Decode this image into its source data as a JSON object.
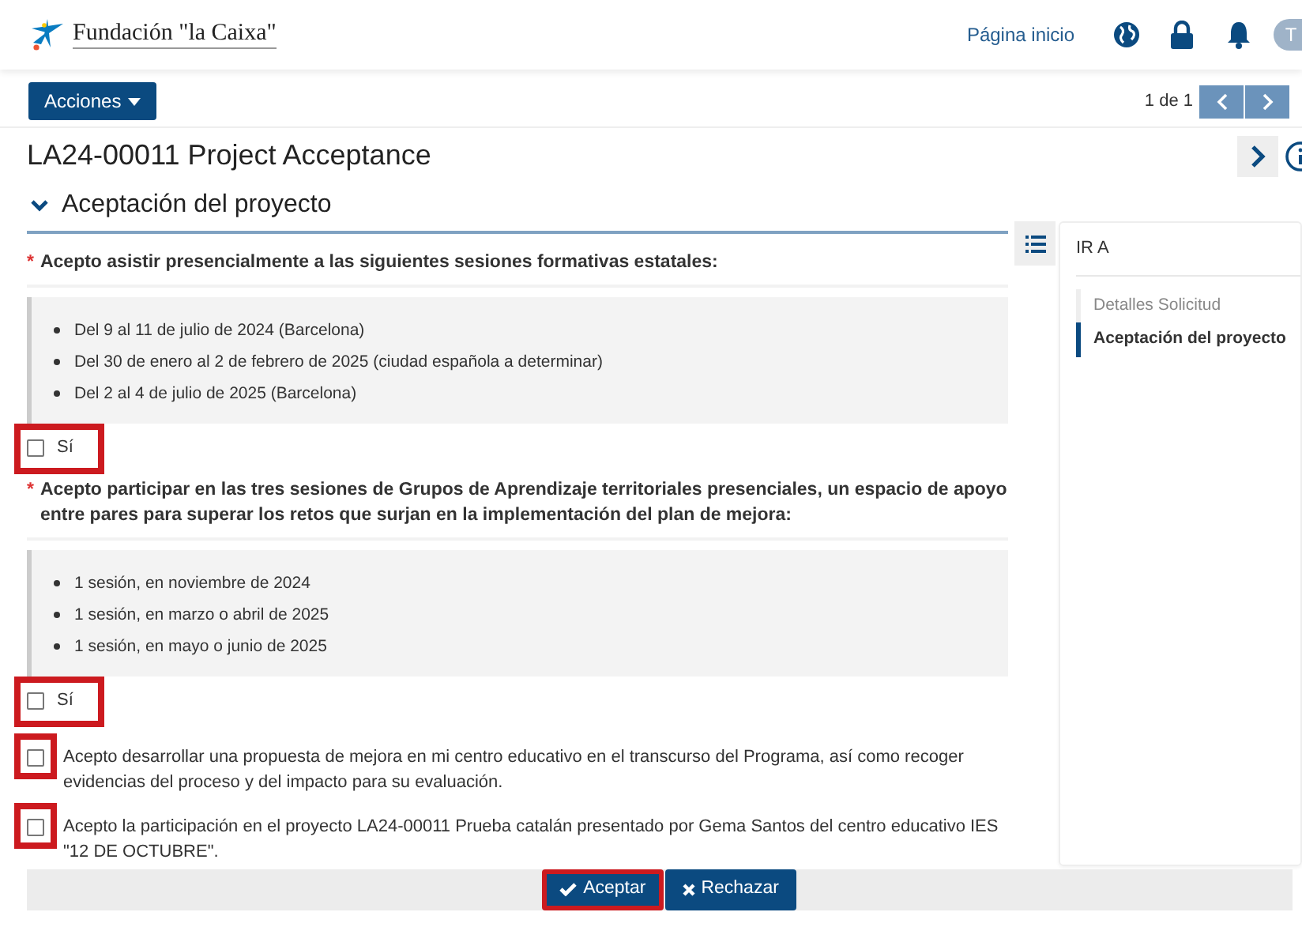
{
  "header": {
    "logo_text": "Fundación \"la Caixa\"",
    "home_link": "Página inicio",
    "avatar_initial": "T"
  },
  "toolbar": {
    "actions_button": "Acciones",
    "pager": "1 de 1"
  },
  "title": "LA24-00011 Project Acceptance",
  "section": {
    "title": "Aceptación del proyecto",
    "expanded": true
  },
  "questions": [
    {
      "kind": "bullets",
      "required_mark": "*",
      "text": "Acepto asistir presencialmente a las siguientes sesiones formativas estatales:",
      "items": [
        "Del 9 al 11 de julio de 2024 (Barcelona)",
        "Del 30 de enero al 2 de febrero de 2025 (ciudad española a determinar)",
        "Del 2 al 4 de julio de 2025 (Barcelona)"
      ],
      "option": {
        "label": "Sí",
        "checked": false,
        "highlighted": true
      }
    },
    {
      "kind": "bullets",
      "required_mark": "*",
      "text": "Acepto participar en las tres sesiones de Grupos de Aprendizaje territoriales presenciales, un espacio de apoyo entre pares para superar los retos que surjan en la implementación del plan de mejora:",
      "items": [
        "1 sesión, en noviembre de 2024",
        "1 sesión, en marzo o abril de 2025",
        "1 sesión, en mayo o junio de 2025"
      ],
      "option": {
        "label": "Sí",
        "checked": false,
        "highlighted": true
      }
    },
    {
      "kind": "checkbox",
      "label": "Acepto desarrollar una propuesta de mejora en mi centro educativo en el transcurso del Programa, así como recoger evidencias del proceso y del impacto para su evaluación.",
      "checked": false,
      "highlighted": true
    },
    {
      "kind": "checkbox",
      "label": "Acepto la participación en el proyecto LA24-00011 Prueba catalán presentado por Gema Santos del centro educativo IES \"12 DE OCTUBRE\".",
      "checked": false,
      "highlighted": true
    }
  ],
  "sidebar": {
    "title": "IR A",
    "items": [
      {
        "label": "Detalles Solicitud",
        "selected": false
      },
      {
        "label": "Aceptación del proyecto",
        "selected": true
      }
    ]
  },
  "footer_buttons": [
    {
      "kind": "accept",
      "label": "Aceptar",
      "highlighted": true
    },
    {
      "kind": "reject",
      "label": "Rechazar",
      "highlighted": false
    }
  ]
}
